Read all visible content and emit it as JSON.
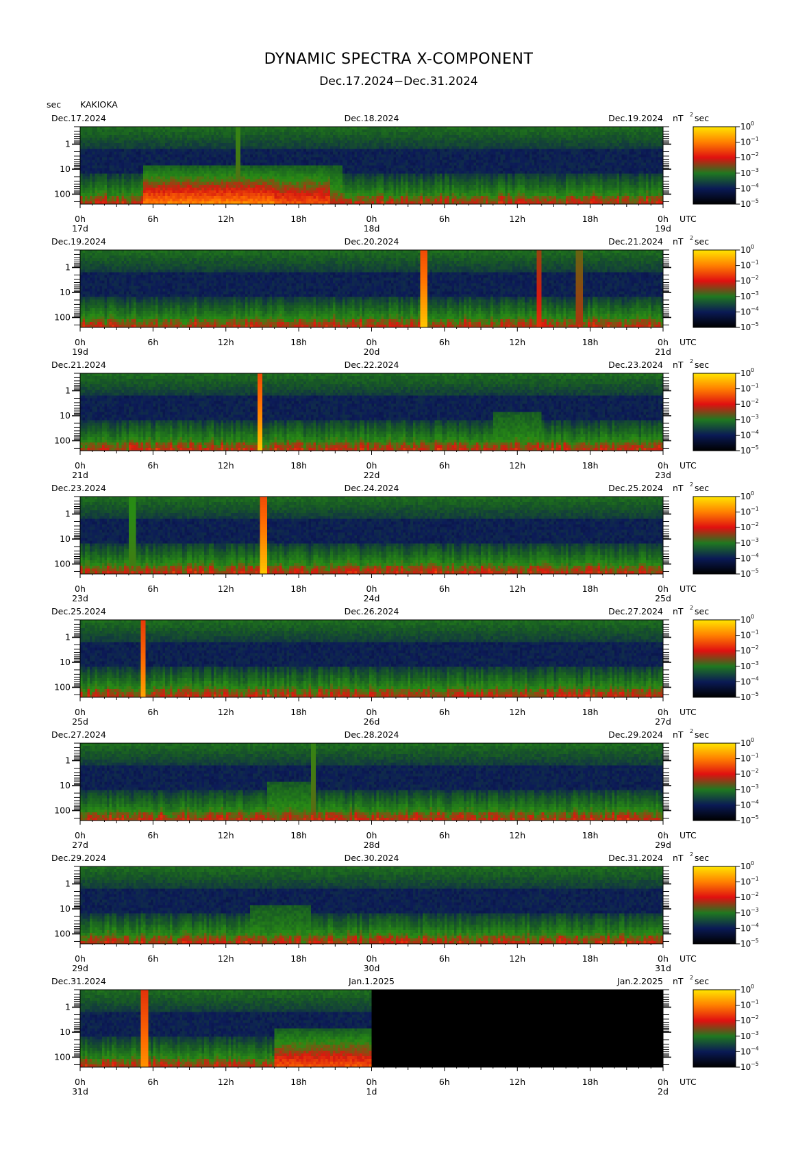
{
  "figure": {
    "title": "DYNAMIC SPECTRA X-COMPONENT",
    "subtitle": "Dec.17.2024−Dec.31.2024",
    "yunit": "sec",
    "station": "KAKIOKA",
    "colorbar_unit": "nT",
    "colorbar_unit_exp": "2",
    "colorbar_unit_sec": "sec",
    "utc_label": "UTC"
  },
  "chart_data": {
    "type": "heatmap",
    "yscale": "log",
    "y_ticks": [
      "1",
      "10",
      "100"
    ],
    "x_ticks": [
      "0h",
      "6h",
      "12h",
      "18h",
      "0h",
      "6h",
      "12h",
      "18h",
      "0h"
    ],
    "colorbar": {
      "scale": "log",
      "ticks": [
        {
          "base": "10",
          "exp": "0"
        },
        {
          "base": "10",
          "exp": "−1"
        },
        {
          "base": "10",
          "exp": "−2"
        },
        {
          "base": "10",
          "exp": "−3"
        },
        {
          "base": "10",
          "exp": "−4"
        },
        {
          "base": "10",
          "exp": "−5"
        }
      ],
      "colors": [
        "#ffe600",
        "#ff8000",
        "#e01010",
        "#207820",
        "#0a1a55",
        "#000000"
      ]
    },
    "panels": [
      {
        "date_left": "Dec.17.2024",
        "date_mid": "Dec.18.2024",
        "date_right": "Dec.19.2024",
        "day_labels": [
          "17d",
          "18d",
          "19d"
        ],
        "data_until_hour": 48,
        "spikes": [
          {
            "hour": 13.0,
            "strength": 0.2
          }
        ],
        "bursts": [
          {
            "h0": 5.2,
            "h1": 16.0,
            "level": 0.95
          },
          {
            "h0": 16.0,
            "h1": 20.5,
            "level": 0.8
          },
          {
            "h0": 20.5,
            "h1": 21.5,
            "level": 0.5
          }
        ]
      },
      {
        "date_left": "Dec.19.2024",
        "date_mid": "Dec.20.2024",
        "date_right": "Dec.21.2024",
        "day_labels": [
          "19d",
          "20d",
          "21d"
        ],
        "data_until_hour": 48,
        "spikes": [
          {
            "hour": 28.3,
            "strength": 1.0
          },
          {
            "hour": 37.8,
            "strength": 0.5
          },
          {
            "hour": 41.1,
            "strength": 0.35
          }
        ],
        "bursts": []
      },
      {
        "date_left": "Dec.21.2024",
        "date_mid": "Dec.22.2024",
        "date_right": "Dec.23.2024",
        "day_labels": [
          "21d",
          "22d",
          "23d"
        ],
        "data_until_hour": 48,
        "spikes": [
          {
            "hour": 14.8,
            "strength": 1.0
          }
        ],
        "bursts": [
          {
            "h0": 34.0,
            "h1": 38.0,
            "level": 0.35
          }
        ]
      },
      {
        "date_left": "Dec.23.2024",
        "date_mid": "Dec.24.2024",
        "date_right": "Dec.25.2024",
        "day_labels": [
          "23d",
          "24d",
          "25d"
        ],
        "data_until_hour": 48,
        "spikes": [
          {
            "hour": 4.3,
            "strength": 0.15
          },
          {
            "hour": 15.1,
            "strength": 1.0
          }
        ],
        "bursts": []
      },
      {
        "date_left": "Dec.25.2024",
        "date_mid": "Dec.26.2024",
        "date_right": "Dec.27.2024",
        "day_labels": [
          "25d",
          "26d",
          "27d"
        ],
        "data_until_hour": 48,
        "spikes": [
          {
            "hour": 5.2,
            "strength": 0.9
          }
        ],
        "bursts": []
      },
      {
        "date_left": "Dec.27.2024",
        "date_mid": "Dec.28.2024",
        "date_right": "Dec.29.2024",
        "day_labels": [
          "27d",
          "28d",
          "29d"
        ],
        "data_until_hour": 48,
        "spikes": [
          {
            "hour": 19.2,
            "strength": 0.2
          }
        ],
        "bursts": [
          {
            "h0": 15.5,
            "h1": 19.0,
            "level": 0.4
          }
        ]
      },
      {
        "date_left": "Dec.29.2024",
        "date_mid": "Dec.30.2024",
        "date_right": "Dec.31.2024",
        "day_labels": [
          "29d",
          "30d",
          "31d"
        ],
        "data_until_hour": 48,
        "spikes": [],
        "bursts": [
          {
            "h0": 14.0,
            "h1": 19.0,
            "level": 0.3
          }
        ]
      },
      {
        "date_left": "Dec.31.2024",
        "date_mid": "Jan.1.2025",
        "date_right": "Jan.2.2025",
        "day_labels": [
          "31d",
          "1d",
          "2d"
        ],
        "data_until_hour": 24,
        "spikes": [
          {
            "hour": 5.3,
            "strength": 0.85
          }
        ],
        "bursts": [
          {
            "h0": 16.0,
            "h1": 24.0,
            "level": 0.8
          }
        ]
      }
    ]
  }
}
